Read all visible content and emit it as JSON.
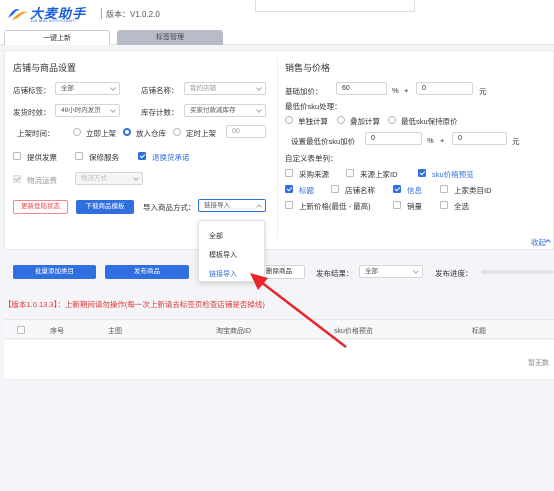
{
  "app": {
    "logo_text": "大麦助手",
    "logo_sub": "DA MAI ASSISTANT",
    "version": "版本：V1.0.2.0"
  },
  "tabs": [
    {
      "label": "一键上新",
      "active": true
    },
    {
      "label": "标签管理",
      "active": false
    }
  ],
  "shop": {
    "title": "店铺与商品设置",
    "shop_tag_label": "店铺标签：",
    "shop_tag_value": "全部",
    "shop_name_label": "店铺名称：",
    "shop_name_placeholder": "我的店铺",
    "ship_time_label": "发货时效：",
    "ship_time_value": "48小时内发货",
    "stock_count_label": "库存计数：",
    "stock_count_value": "买家付款减库存",
    "listing_time_label": "上架时间：",
    "listing_options": [
      {
        "label": "立即上架",
        "selected": false
      },
      {
        "label": "放入仓库",
        "selected": true
      },
      {
        "label": "定时上架",
        "selected": false
      }
    ],
    "time_placeholder": "00",
    "services": [
      {
        "label": "提供发票",
        "checked": false
      },
      {
        "label": "保修服务",
        "checked": false
      },
      {
        "label": "退换货承诺",
        "checked": true
      }
    ],
    "logistics_label": "物流运费",
    "logistics_select": "物流方式",
    "btn_update_status": "更新登陆状态",
    "btn_download_template": "下载商品模板",
    "import_label": "导入商品方式：",
    "import_value": "链接导入"
  },
  "dropdown": {
    "options": [
      {
        "label": "全部",
        "active": false
      },
      {
        "label": "模板导入",
        "active": false
      },
      {
        "label": "链接导入",
        "active": true
      }
    ]
  },
  "sales": {
    "title": "销售与价格",
    "base_markup_label": "基础加价：",
    "base_markup_value": "60",
    "percent": "%",
    "plus": "+",
    "base_markup_add": "0",
    "yuan": "元",
    "min_sku_label": "最低价sku处理：",
    "sku_options": [
      {
        "label": "单独计算",
        "selected": false
      },
      {
        "label": "叠加计算",
        "selected": false
      },
      {
        "label": "最低sku保持原价",
        "selected": false
      }
    ],
    "set_min_label": "设置最低价sku加价",
    "set_min_value": "0",
    "set_min_add": "0",
    "custom_cols_label": "自定义表单列：",
    "columns": [
      {
        "label": "采购来源",
        "checked": false
      },
      {
        "label": "来源上家ID",
        "checked": false
      },
      {
        "label": "sku价格预览",
        "checked": true
      },
      {
        "label": "标题",
        "checked": true
      },
      {
        "label": "店铺名称",
        "checked": false
      },
      {
        "label": "信息",
        "checked": true
      },
      {
        "label": "上家类目ID",
        "checked": false
      },
      {
        "label": "上新价格(最低 - 最高)",
        "checked": false
      },
      {
        "label": "销量",
        "checked": false
      },
      {
        "label": "全选",
        "checked": false
      }
    ],
    "collapse": "收起"
  },
  "actions": {
    "batch_add": "批量添加类目",
    "publish": "发布商品",
    "delete_product": "删除商品",
    "publish_result_label": "发布结果：",
    "publish_result_value": "全部",
    "publish_progress_label": "发布进度：",
    "progress": 0
  },
  "notice": "【版本1.0.13.3】：上新期间请勿操作(每一次上新请去标签页检查店铺是否掉线)",
  "table": {
    "headers": [
      "序号",
      "主图",
      "淘宝商品ID",
      "sku价格预览",
      "标题"
    ],
    "empty": "暂无数"
  },
  "colors": {
    "primary": "#2f6fe0",
    "danger": "#e03535",
    "arrow": "#e8262a"
  }
}
